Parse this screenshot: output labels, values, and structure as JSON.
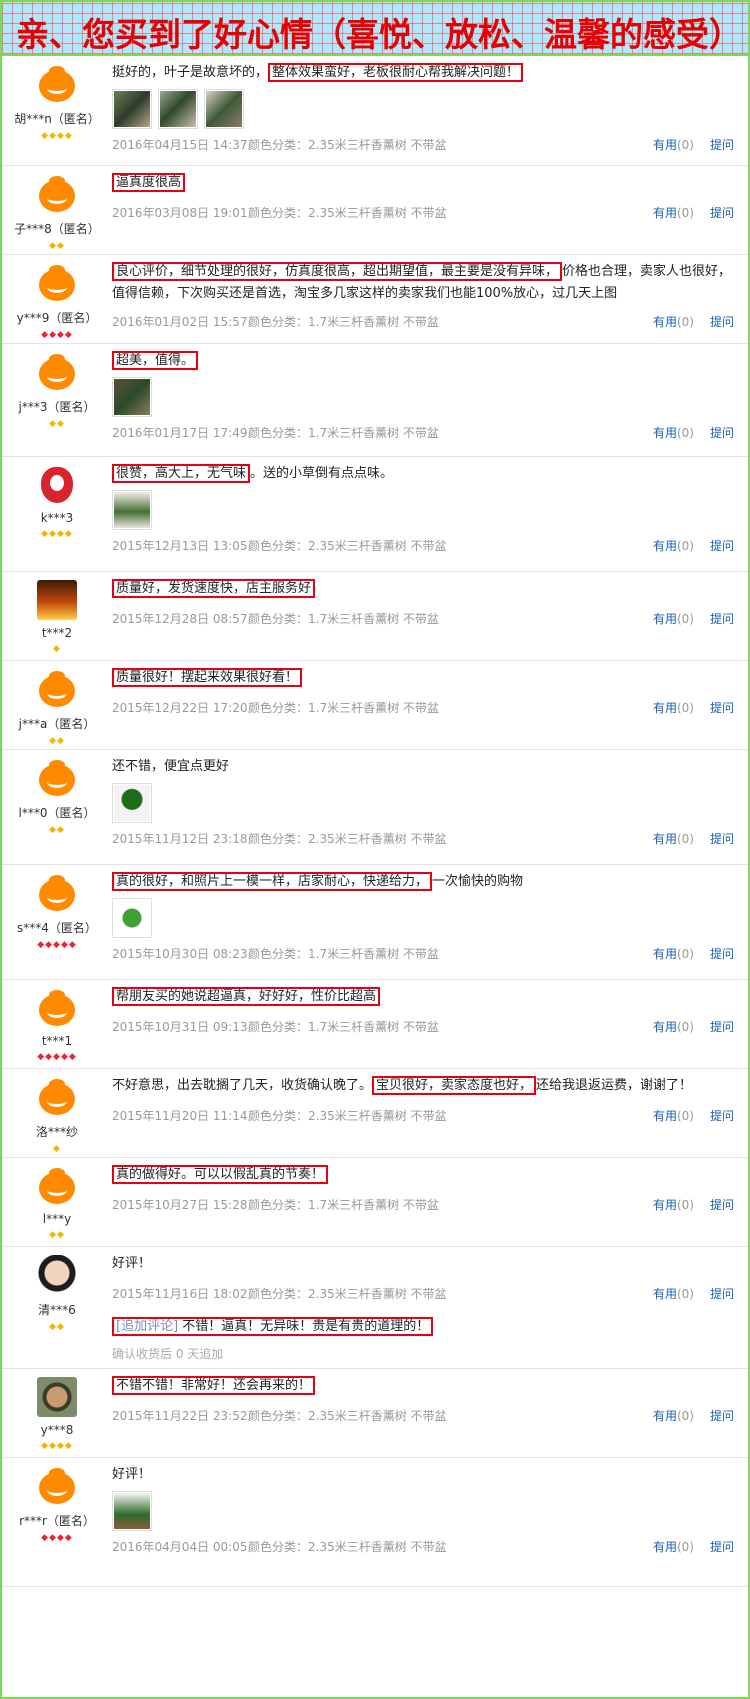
{
  "banner": {
    "title": "亲、您买到了好心情（喜悦、放松、温馨的感受）"
  },
  "labels": {
    "spec_prefix": "颜色分类：",
    "useful": "有用",
    "question": "提问"
  },
  "reviews": [
    {
      "user": "胡***n（匿名）",
      "badges": "◆◆◆◆",
      "badge_color": "gold",
      "avatar": "orange",
      "before": "挺好的，叶子是故意坏的，",
      "hl": "整体效果蛮好，老板很耐心帮我解决问题！",
      "after": "",
      "thumbs": [
        "plant1",
        "plant2",
        "plant3"
      ],
      "date": "2016年04月15日 14:37",
      "spec": "2.35米三杆香薰树 不带盆",
      "useful_count": "(0)"
    },
    {
      "user": "子***8（匿名）",
      "badges": "◆◆",
      "badge_color": "gold",
      "avatar": "orange",
      "before": "",
      "hl": "逼真度很高",
      "after": "",
      "thumbs": [],
      "date": "2016年03月08日 19:01",
      "spec": "2.35米三杆香薰树 不带盆",
      "useful_count": "(0)"
    },
    {
      "user": "y***9（匿名）",
      "badges": "◆◆◆◆",
      "badge_color": "red",
      "avatar": "orange",
      "before": "",
      "hl": "良心评价，细节处理的很好，仿真度很高，超出期望值，最主要是没有异味，",
      "after": "价格也合理，卖家人也很好，值得信赖，下次购买还是首选，淘宝多几家这样的卖家我们也能100%放心，过几天上图",
      "thumbs": [],
      "date": "2016年01月02日 15:57",
      "spec": "1.7米三杆香薰树 不带盆",
      "useful_count": "(0)"
    },
    {
      "user": "j***3（匿名）",
      "badges": "◆◆",
      "badge_color": "gold",
      "avatar": "orange",
      "before": "",
      "hl": "超美，值得。",
      "after": "",
      "thumbs": [
        "plant4"
      ],
      "date": "2016年01月17日 17:49",
      "spec": "1.7米三杆香薰树 不带盆",
      "useful_count": "(0)"
    },
    {
      "user": "k***3",
      "badges": "◆◆◆◆",
      "badge_color": "gold",
      "avatar": "red",
      "before": "",
      "hl": "很赞，高大上，无气味",
      "after": "。送的小草倒有点点味。",
      "thumbs": [
        "plant5"
      ],
      "date": "2015年12月13日 13:05",
      "spec": "2.35米三杆香薰树 不带盆",
      "useful_count": "(0)"
    },
    {
      "user": "t***2",
      "badges": "◆",
      "badge_color": "gold",
      "avatar": "fire",
      "before": "",
      "hl": "质量好，发货速度快，店主服务好",
      "after": "",
      "thumbs": [],
      "date": "2015年12月28日 08:57",
      "spec": "1.7米三杆香薰树 不带盆",
      "useful_count": "(0)"
    },
    {
      "user": "j***a（匿名）",
      "badges": "◆◆",
      "badge_color": "gold",
      "avatar": "orange",
      "before": "",
      "hl": "质量很好！摆起来效果很好看！",
      "after": "",
      "thumbs": [],
      "date": "2015年12月22日 17:20",
      "spec": "1.7米三杆香薰树 不带盆",
      "useful_count": "(0)"
    },
    {
      "user": "l***0（匿名）",
      "badges": "◆◆",
      "badge_color": "gold",
      "avatar": "orange",
      "before": "还不错，便宜点更好",
      "hl": "",
      "after": "",
      "thumbs": [
        "plant6"
      ],
      "date": "2015年11月12日 23:18",
      "spec": "2.35米三杆香薰树 不带盆",
      "useful_count": "(0)"
    },
    {
      "user": "s***4（匿名）",
      "badges": "◆◆◆◆◆",
      "badge_color": "red",
      "avatar": "orange",
      "before": "",
      "hl": "真的很好，和照片上一模一样，店家耐心，快递给力，",
      "after": "一次愉快的购物",
      "thumbs": [
        "plant7"
      ],
      "date": "2015年10月30日 08:23",
      "spec": "1.7米三杆香薰树 不带盆",
      "useful_count": "(0)"
    },
    {
      "user": "t***1",
      "badges": "◆◆◆◆◆",
      "badge_color": "red",
      "avatar": "orange",
      "before": "",
      "hl": "帮朋友买的她说超逼真，好好好，性价比超高",
      "after": "",
      "thumbs": [],
      "date": "2015年10月31日 09:13",
      "spec": "1.7米三杆香薰树 不带盆",
      "useful_count": "(0)"
    },
    {
      "user": "洛***纱",
      "badges": "◆",
      "badge_color": "gold",
      "avatar": "orange",
      "before": "不好意思，出去耽搁了几天，收货确认晚了。",
      "hl": "宝贝很好，卖家态度也好，",
      "after": "还给我退返运费，谢谢了！",
      "thumbs": [],
      "date": "2015年11月20日 11:14",
      "spec": "2.35米三杆香薰树 不带盆",
      "useful_count": "(0)"
    },
    {
      "user": "l***y",
      "badges": "◆◆",
      "badge_color": "gold",
      "avatar": "orange",
      "before": "",
      "hl": "真的做得好。可以以假乱真的节奏！",
      "after": "",
      "thumbs": [],
      "date": "2015年10月27日 15:28",
      "spec": "1.7米三杆香薰树 不带盆",
      "useful_count": "(0)"
    },
    {
      "user": "清***6",
      "badges": "◆◆",
      "badge_color": "gold",
      "avatar": "woman",
      "before": "好评！",
      "hl": "",
      "after": "",
      "thumbs": [],
      "date": "2015年11月16日 18:02",
      "spec": "2.35米三杆香薰树 不带盆",
      "useful_count": "(0)",
      "append_tag": "[追加评论]",
      "append_text": "不错！逼真！无异味！贵是有贵的道理的！",
      "append_after": "确认收货后 0 天追加"
    },
    {
      "user": "y***8",
      "badges": "◆◆◆◆",
      "badge_color": "gold",
      "avatar": "man",
      "before": "",
      "hl": "不错不错！非常好！还会再来的！",
      "after": "",
      "thumbs": [],
      "date": "2015年11月22日 23:52",
      "spec": "2.35米三杆香薰树 不带盆",
      "useful_count": "(0)"
    },
    {
      "user": "r***r（匿名）",
      "badges": "◆◆◆◆",
      "badge_color": "red",
      "avatar": "orange",
      "before": "好评！",
      "hl": "",
      "after": "",
      "thumbs": [
        "plant8"
      ],
      "date": "2016年04月04日 00:05",
      "spec": "2.35米三杆香薰树 不带盆",
      "useful_count": "(0)"
    }
  ]
}
